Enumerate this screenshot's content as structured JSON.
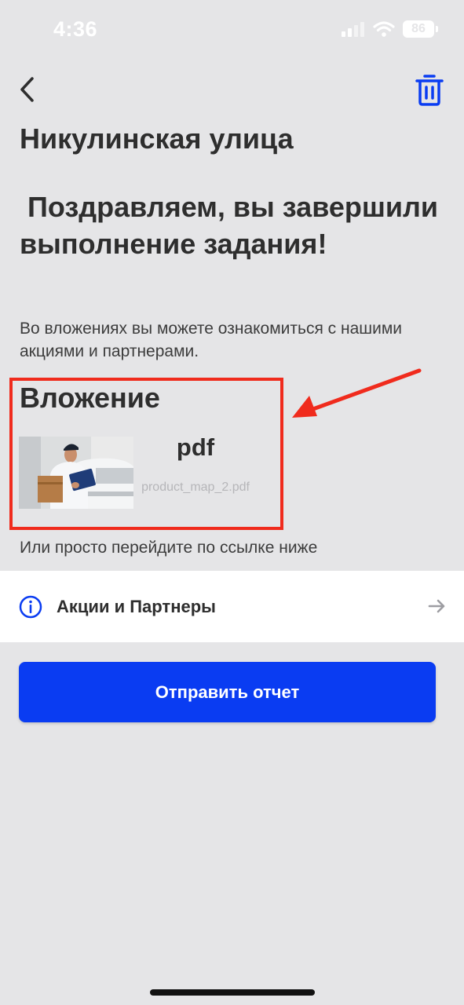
{
  "status_bar": {
    "time": "4:36",
    "battery": "86"
  },
  "header": {
    "back_icon": "chevron-left-icon",
    "delete_icon": "trash-icon"
  },
  "title": "Никулинская улица",
  "congrats_message": " Поздравляем, вы завершили выполнение задания!",
  "description": "Во вложениях вы можете ознакомиться с нашими акциями и партнерами.",
  "attachment": {
    "heading": "Вложение",
    "type": "pdf",
    "filename": "product_map_2.pdf"
  },
  "link_hint": "Или просто перейдите по ссылке ниже",
  "link_row": {
    "icon": "info-icon",
    "label": "Акции и Партнеры",
    "trailing_icon": "arrow-right-icon"
  },
  "submit_button": {
    "label": "Отправить отчет"
  },
  "colors": {
    "background": "#e5e5e7",
    "accent": "#0a3cf2",
    "annotation": "#f02b1d",
    "text": "#2e2e2e"
  }
}
